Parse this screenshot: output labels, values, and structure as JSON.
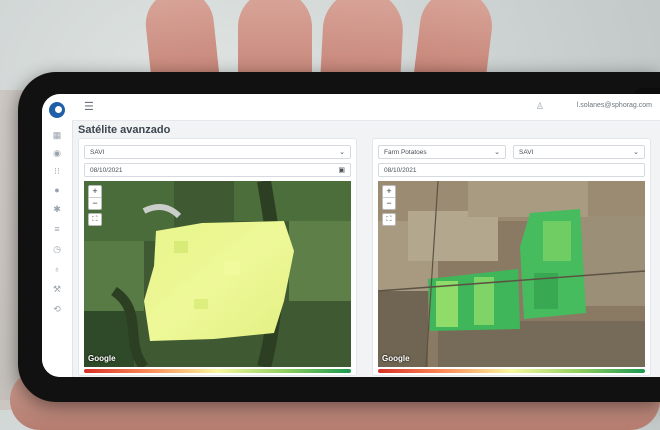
{
  "app": {
    "user_email": "l.solanes@sphorag.com",
    "page_title": "Satélite avanzado"
  },
  "rail_icons": [
    "grid-icon",
    "layers-icon",
    "filter-icon",
    "drop-icon",
    "sprout-icon",
    "list-icon",
    "clock-icon",
    "pin-icon",
    "tractor-icon",
    "link-icon"
  ],
  "left_panel": {
    "index_select": "SAVI",
    "date": "08/10/2021",
    "map_attribution": "Google",
    "zoom_in": "+",
    "zoom_out": "−",
    "fullscreen": "⛶"
  },
  "right_panel": {
    "field_select": "Farm Potatoes",
    "index_select": "SAVI",
    "date": "08/10/2021",
    "map_attribution": "Google",
    "zoom_in": "+",
    "zoom_out": "−",
    "fullscreen": "⛶"
  },
  "colors": {
    "scale_low": "#d73027",
    "scale_mid": "#f7f7a0",
    "scale_high": "#1a9850",
    "brand": "#1f5fa8"
  }
}
